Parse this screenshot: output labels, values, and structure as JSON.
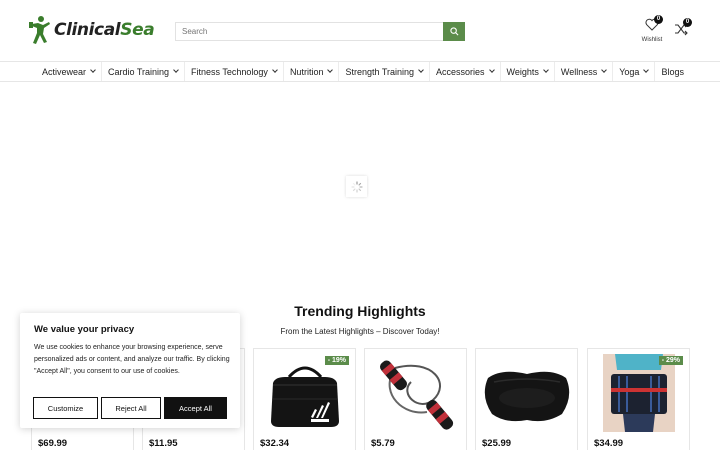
{
  "header": {
    "logo": {
      "text_main": "Clinical",
      "text_accent": "Sea"
    },
    "search": {
      "placeholder": "Search",
      "icon": "search-icon"
    },
    "wishlist": {
      "label": "Wishlist",
      "count": "0",
      "icon": "heart-icon"
    },
    "compare": {
      "count": "0",
      "icon": "shuffle-icon"
    }
  },
  "nav": {
    "items": [
      {
        "label": "Activewear",
        "dropdown": true
      },
      {
        "label": "Cardio Training",
        "dropdown": true
      },
      {
        "label": "Fitness Technology",
        "dropdown": true
      },
      {
        "label": "Nutrition",
        "dropdown": true
      },
      {
        "label": "Strength Training",
        "dropdown": true
      },
      {
        "label": "Accessories",
        "dropdown": true
      },
      {
        "label": "Weights",
        "dropdown": true
      },
      {
        "label": "Wellness",
        "dropdown": true
      },
      {
        "label": "Yoga",
        "dropdown": true
      },
      {
        "label": "Blogs",
        "dropdown": false
      }
    ]
  },
  "trending": {
    "title": "Trending Highlights",
    "subtitle": "From the Latest Highlights – Discover Today!",
    "products": [
      {
        "price": "$69.99",
        "discount": "",
        "image": "hidden"
      },
      {
        "price": "$11.95",
        "discount": "",
        "image": "hidden"
      },
      {
        "price": "$32.34",
        "discount": "- 19%",
        "image": "duffel-bag"
      },
      {
        "price": "$5.79",
        "discount": "",
        "image": "jump-rope"
      },
      {
        "price": "$25.99",
        "discount": "",
        "image": "meditation-cushion"
      },
      {
        "price": "$34.99",
        "discount": "- 29%",
        "image": "back-brace"
      }
    ]
  },
  "cookie": {
    "title": "We value your privacy",
    "body": "We use cookies to enhance your browsing experience, serve personalized ads or content, and analyze our traffic. By clicking \"Accept All\", you consent to our use of cookies.",
    "customize": "Customize",
    "reject": "Reject All",
    "accept": "Accept All"
  },
  "colors": {
    "accent": "#5b8c4a",
    "text": "#222222",
    "dark": "#111111"
  }
}
